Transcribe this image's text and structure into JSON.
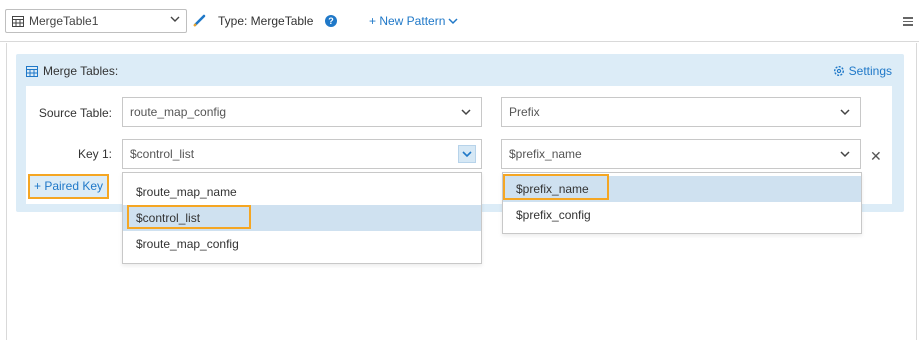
{
  "toolbar": {
    "table_select_value": "MergeTable1",
    "type_label": "Type: MergeTable",
    "help_glyph": "?",
    "new_pattern_label": "+ New Pattern"
  },
  "panel": {
    "title": "Merge Tables:",
    "settings_label": "Settings"
  },
  "form": {
    "source_table_label": "Source Table:",
    "source_table_value": "route_map_config",
    "prefix_select_value": "Prefix",
    "key1_label": "Key 1:",
    "key1_value": "$control_list",
    "key1_right_value": "$prefix_name",
    "remove_glyph": "✕",
    "paired_key_label": "+ Paired Key"
  },
  "left_dropdown": {
    "options": [
      "$route_map_name",
      "$control_list",
      "$route_map_config"
    ],
    "highlighted": 1
  },
  "right_dropdown": {
    "options": [
      "$prefix_name",
      "$prefix_config"
    ],
    "highlighted": 0
  },
  "colors": {
    "accent": "#1f78c8",
    "panel_bg": "#dcecf7",
    "highlight": "#cfe1f0",
    "callout": "#f5a623"
  }
}
